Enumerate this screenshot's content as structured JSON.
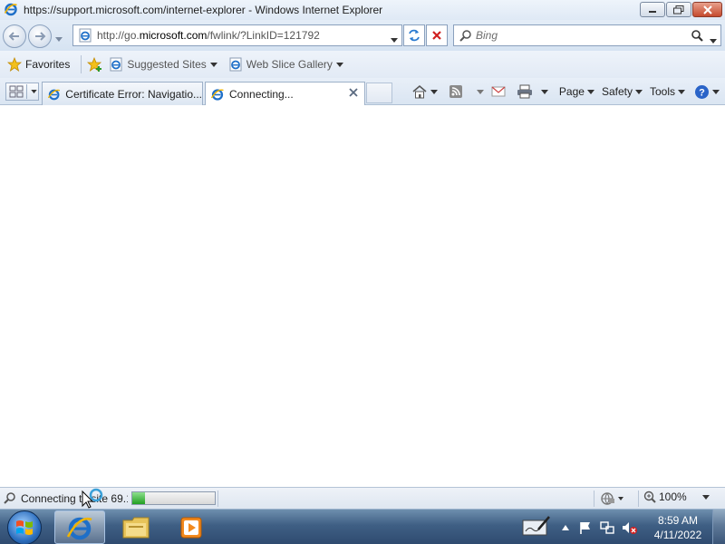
{
  "window": {
    "title": "https://support.microsoft.com/internet-explorer - Windows Internet Explorer"
  },
  "nav": {
    "address_prefix": "http://go.",
    "address_domain": "microsoft.com",
    "address_suffix": "/fwlink/?LinkID=121792",
    "search_placeholder": "Bing"
  },
  "favorites_bar": {
    "favorites_label": "Favorites",
    "items": [
      "Suggested Sites",
      "Web Slice Gallery"
    ]
  },
  "tabs": [
    {
      "label": "Certificate Error: Navigatio..."
    },
    {
      "label": "Connecting..."
    }
  ],
  "command_bar": {
    "page": "Page",
    "safety": "Safety",
    "tools": "Tools"
  },
  "status": {
    "text": "Connecting to site 69.1",
    "progress_percent": 15,
    "zoom": "100%"
  },
  "taskbar": {
    "time": "8:59 AM",
    "date": "4/11/2022"
  },
  "icons": {
    "ie": "ie-logo-icon",
    "back": "back-arrow-icon",
    "forward": "forward-arrow-icon",
    "refresh": "refresh-icon",
    "stop": "stop-icon",
    "search": "search-icon",
    "favorites": "favorites-star-icon",
    "home": "home-icon",
    "feeds": "rss-feed-icon",
    "mail": "mail-icon",
    "print": "printer-icon",
    "help": "help-icon"
  },
  "colors": {
    "ie_blue": "#1e6fc8",
    "progress_green": "#22a022",
    "taskbar_blue": "#3f5f84"
  }
}
